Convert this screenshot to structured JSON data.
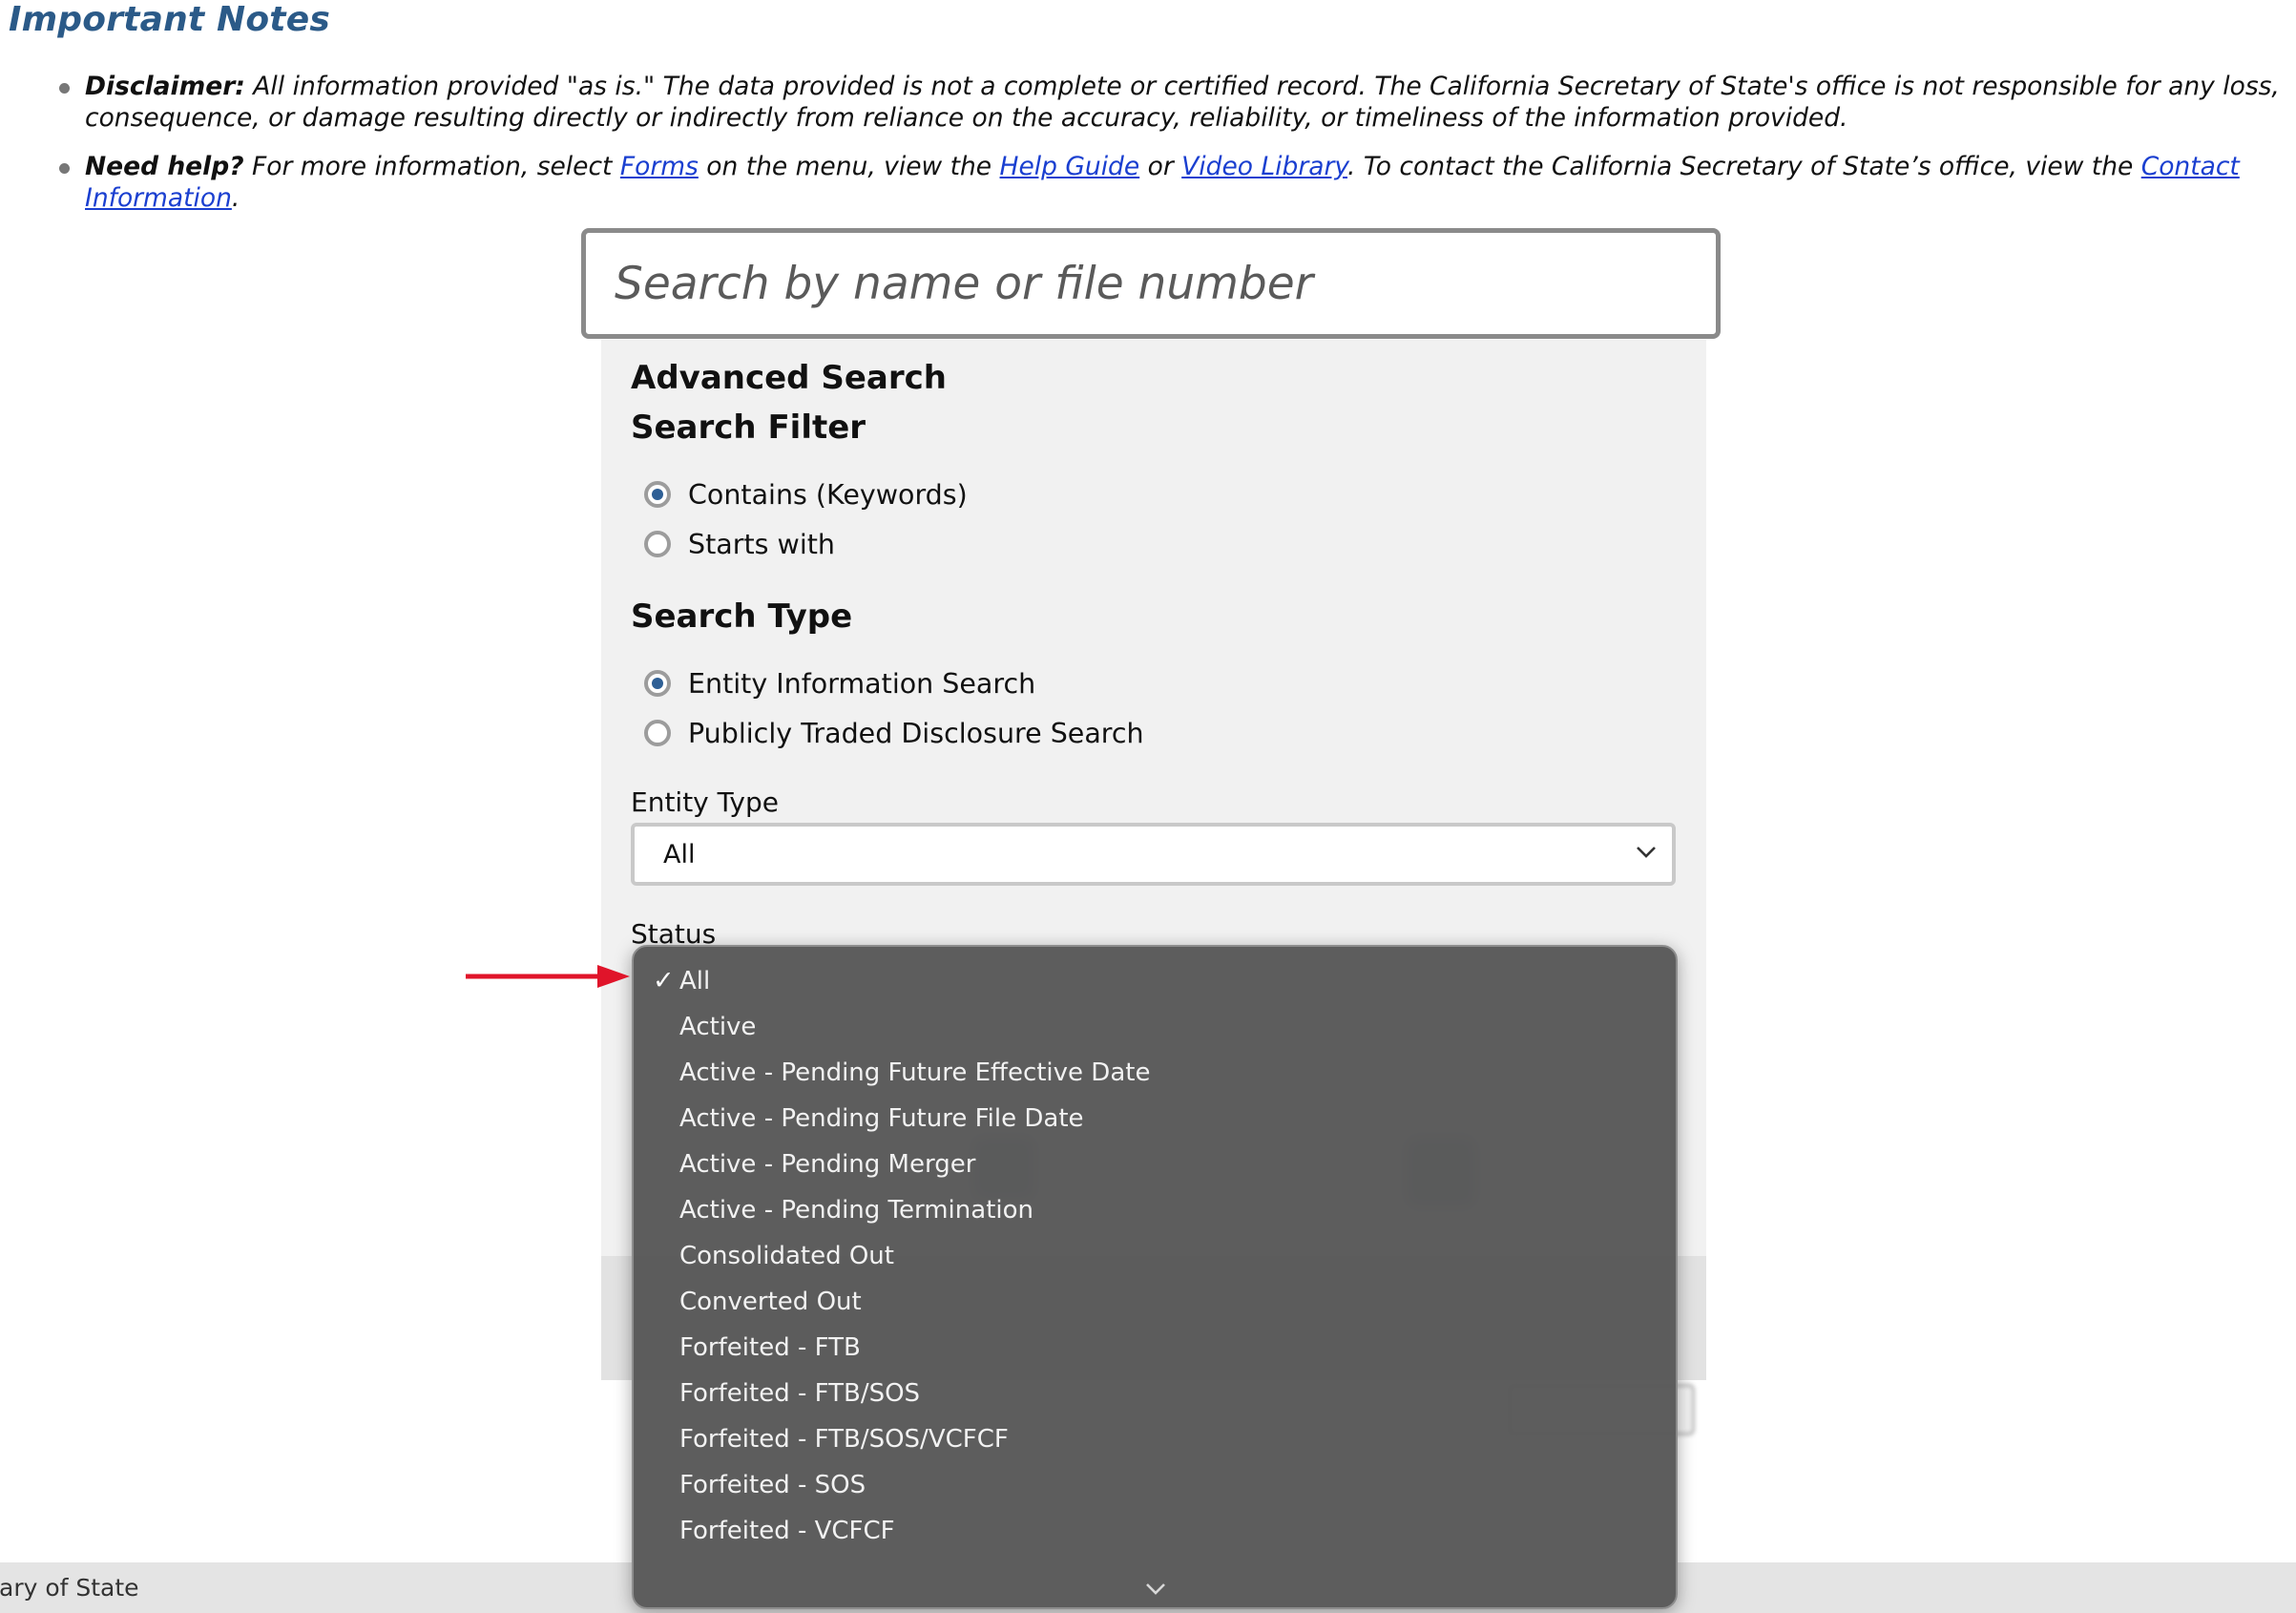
{
  "notes": {
    "title": "Important Notes",
    "disclaimer": {
      "label": "Disclaimer:",
      "text": " All information provided \"as is.\" The data provided is not a complete or certified record. The California Secretary of State's office is not responsible for any loss, consequence, or damage resulting directly or indirectly from reliance on the accuracy, reliability, or timeliness of the information provided."
    },
    "help": {
      "label": "Need help?",
      "text_1": " For more information, select ",
      "link_forms": "Forms",
      "text_2": " on the menu, view the ",
      "link_help_guide": "Help Guide",
      "text_3": " or ",
      "link_video_library": "Video Library",
      "text_4": ". To contact the California Secretary of State’s office, view the ",
      "link_contact": "Contact Information",
      "text_5": "."
    }
  },
  "search": {
    "placeholder": "Search by name or file number"
  },
  "advanced": {
    "title": "Advanced Search",
    "filter_title": "Search Filter",
    "filter_options": [
      "Contains (Keywords)",
      "Starts with"
    ],
    "filter_selected": "Contains (Keywords)",
    "type_title": "Search Type",
    "type_options": [
      "Entity Information Search",
      "Publicly Traded Disclosure Search"
    ],
    "type_selected": "Entity Information Search",
    "entity_type_label": "Entity Type",
    "entity_type_value": "All",
    "status_label": "Status"
  },
  "status_dropdown": {
    "selected": "All",
    "check_mark": "✓",
    "options": [
      "All",
      "Active",
      "Active - Pending Future Effective Date",
      "Active - Pending Future File Date",
      "Active - Pending Merger",
      "Active - Pending Termination",
      "Consolidated Out",
      "Converted Out",
      "Forfeited - FTB",
      "Forfeited - FTB/SOS",
      "Forfeited - FTB/SOS/VCFCF",
      "Forfeited - SOS",
      "Forfeited - VCFCF"
    ]
  },
  "footer": {
    "text": "ary of State"
  },
  "icons": {
    "select_chevron": "chevron-down-icon",
    "dropdown_scroll": "chevron-down-icon",
    "annotation": "red-arrow-icon"
  },
  "colors": {
    "notes_title": "#2b5a88",
    "radio_checked": "#2e5f95",
    "link": "#1a3fd0",
    "dropdown_bg": "#585858",
    "annotation_arrow": "#e0142a"
  }
}
